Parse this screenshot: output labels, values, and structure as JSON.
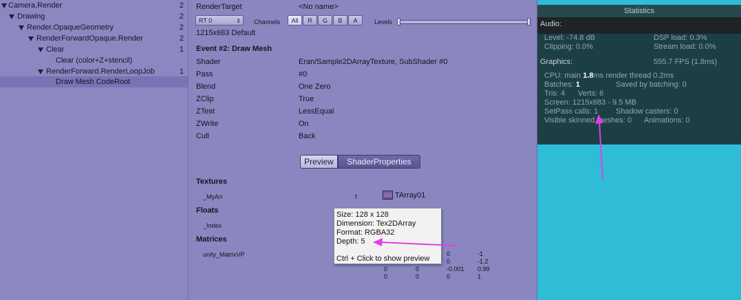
{
  "hierarchy": [
    {
      "label": "Camera.Render",
      "count": "2"
    },
    {
      "label": "Drawing",
      "count": "2"
    },
    {
      "label": "Render.OpaqueGeometry",
      "count": "2"
    },
    {
      "label": "RenderForwardOpaque.Render",
      "count": "2"
    },
    {
      "label": "Clear",
      "count": "1"
    },
    {
      "label": "Clear (color+Z+stencil)",
      "count": ""
    },
    {
      "label": "RenderForward.RenderLoopJob",
      "count": "1"
    },
    {
      "label": "Draw Mesh CodeRoot",
      "count": ""
    }
  ],
  "toolbar": {
    "render_target_label": "RenderTarget",
    "render_target_value": "<No name>",
    "rt_dropdown": "RT 0",
    "channels_label": "Channels",
    "channels": [
      "All",
      "R",
      "G",
      "B",
      "A"
    ],
    "levels_label": "Levels",
    "resolution": "1215x683 Default"
  },
  "event": {
    "title": "Event #2: Draw Mesh",
    "props": [
      {
        "key": "Shader",
        "value": "Eran/Sample2DArrayTexture, SubShader #0"
      },
      {
        "key": "Pass",
        "value": "#0"
      },
      {
        "key": "Blend",
        "value": "One Zero"
      },
      {
        "key": "ZClip",
        "value": "True"
      },
      {
        "key": "ZTest",
        "value": "LessEqual"
      },
      {
        "key": "ZWrite",
        "value": "On"
      },
      {
        "key": "Cull",
        "value": "Back"
      }
    ]
  },
  "tabs": {
    "preview": "Preview",
    "shader_properties": "ShaderProperties"
  },
  "sections": {
    "textures": "Textures",
    "texture_name": "_MyArr",
    "texture_stage": "f",
    "texture_value": "TArray01",
    "floats": "Floats",
    "float_name": "_Index",
    "matrices": "Matrices",
    "matrix_name": "unity_MatrixVP",
    "matrix_rows": [
      [
        "",
        "",
        "0",
        "-1"
      ],
      [
        "",
        "",
        "0",
        "-1.2"
      ],
      [
        "0",
        "0",
        "-0.001",
        "0.99"
      ],
      [
        "0",
        "0",
        "0",
        "1"
      ]
    ]
  },
  "tooltip": {
    "size": "Size: 128 x 128",
    "dimension": "Dimension: Tex2DArray",
    "format": "Format: RGBA32",
    "depth": "Depth: 5",
    "hint": "Ctrl + Click to show preview"
  },
  "stats": {
    "title": "Statistics",
    "audio_header": "Audio:",
    "level": "Level: -74.8 dB",
    "dsp": "DSP load: 0.3%",
    "clipping": "Clipping: 0.0%",
    "stream": "Stream load: 0.0%",
    "graphics_header": "Graphics:",
    "fps": "555.7 FPS (1.8ms)",
    "cpu_prefix": "CPU: main ",
    "cpu_main": "1.8",
    "cpu_suffix": "ms  render thread 0.2ms",
    "batches_prefix": "Batches: ",
    "batches": "1",
    "saved_batching": "Saved by batching: 0",
    "tris": "Tris: 4",
    "verts": "Verts: 6",
    "screen": "Screen: 1215x683 - 9.5 MB",
    "setpass": "SetPass calls: 1",
    "shadow": "Shadow casters: 0",
    "skinned": "Visible skinned meshes: 0",
    "animations": "Animations: 0"
  },
  "colors": {
    "annotation_arrow": "#e23ee6",
    "game_background": "#2ebcd6",
    "stats_panel": "#1c3f46"
  }
}
